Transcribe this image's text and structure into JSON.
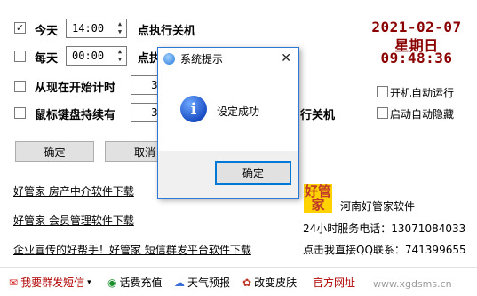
{
  "rows": [
    {
      "checked": true,
      "label": "今天",
      "time": "14:00",
      "suffix": "点执行关机"
    },
    {
      "checked": false,
      "label": "每天",
      "time": "00:00",
      "suffix": "点执"
    }
  ],
  "countdown": {
    "label": "从现在开始计时",
    "value": "3"
  },
  "idle": {
    "label": "鼠标键盘持续有",
    "value": "3",
    "suffix": "行关机"
  },
  "clock": {
    "date": "2021-02-07",
    "weekday": "星期日",
    "time": "09:48:36"
  },
  "options": {
    "autostart": "开机自动运行",
    "autohide": "启动自动隐藏"
  },
  "buttons": {
    "ok": "确定",
    "cancel": "取消"
  },
  "links": [
    "好管家 房产中介软件下载",
    "好管家 会员管理软件下载",
    "企业宣传的好帮手！好管家 短信群发平台软件下载"
  ],
  "company": {
    "logo": "好管家",
    "name": "河南好管家软件",
    "phone": "24小时服务电话：13071084033",
    "qq": "点击我直接QQ联系：741399655"
  },
  "dialog": {
    "title": "系统提示",
    "message": "设定成功",
    "ok": "确定",
    "close_glyph": "✕"
  },
  "bottombar": {
    "sms": "我要群发短信",
    "sms_caret": "▾",
    "recharge": "话费充值",
    "weather": "天气预报",
    "skin": "改变皮肤",
    "website": "官方网址",
    "url": "www.xgdsms.cn"
  },
  "watermark": "www.xgdsms.cn"
}
